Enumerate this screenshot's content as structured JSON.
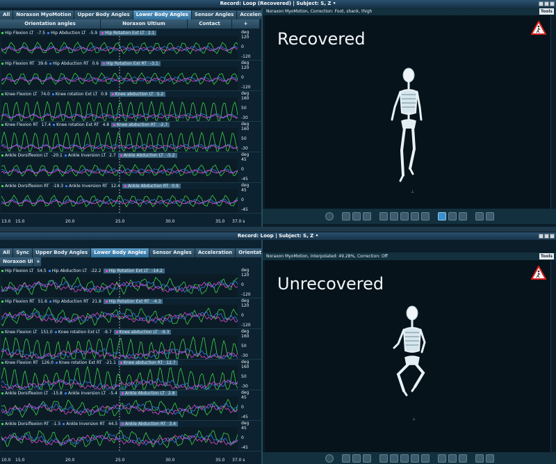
{
  "colors": {
    "green": "#3cd64a",
    "blue": "#3a78e8",
    "pink": "#e04ad0",
    "teal": "#38c0a8",
    "accent": "#3d8fcc"
  },
  "top": {
    "title": "Record: Loop (Recovered) | Subject: S, Z •",
    "tabs": [
      "All",
      "Noraxon MyoMotion",
      "Upper Body Angles",
      "Lower Body Angles",
      "Sensor Angles",
      "Acceleration"
    ],
    "active_tab": "Lower Body Angles",
    "subtabs": [
      "Orientation angles",
      "Noraxon Ultium",
      "Contact",
      "+"
    ],
    "view_header": "Noraxon MyoMotion, Correction: Foot, shank, thigh",
    "tools_label": "Tools",
    "overlay_label": "Recovered",
    "time_ticks": [
      "13.0",
      "15.0",
      "20.0",
      "25.0",
      "30.0",
      "35.0",
      "37.0 s"
    ],
    "unit": "deg",
    "rows": [
      {
        "legend": [
          {
            "label": "Hip Flexion LT",
            "value": "-7.5"
          },
          {
            "label": "Hip Abduction LT",
            "value": "-5.9"
          },
          {
            "label": "Hip Rotation Ext LT",
            "value": "2.1"
          }
        ],
        "yticks": [
          "120",
          "0",
          "-120"
        ]
      },
      {
        "legend": [
          {
            "label": "Hip Flexion RT",
            "value": "39.6"
          },
          {
            "label": "Hip Abduction RT",
            "value": "0.6"
          },
          {
            "label": "Hip Rotation Ext RT",
            "value": "-3.1"
          }
        ],
        "yticks": [
          "120",
          "0",
          "-120"
        ]
      },
      {
        "legend": [
          {
            "label": "Knee Flexion LT",
            "value": "74.0"
          },
          {
            "label": "Knee rotation Ext LT",
            "value": "0.9"
          },
          {
            "label": "Knee abduction LT",
            "value": "5.2"
          }
        ],
        "yticks": [
          "160",
          "50",
          "-30"
        ]
      },
      {
        "legend": [
          {
            "label": "Knee Flexion RT",
            "value": "17.4"
          },
          {
            "label": "Knee rotation Ext RT",
            "value": "4.8"
          },
          {
            "label": "Knee abduction RT",
            "value": "-2.7"
          }
        ],
        "yticks": [
          "160",
          "50",
          "-30"
        ]
      },
      {
        "legend": [
          {
            "label": "Ankle Dorsiflexion LT",
            "value": "-20.1"
          },
          {
            "label": "Ankle Inversion LT",
            "value": "2.7"
          },
          {
            "label": "Ankle Abduction LT",
            "value": "-5.2"
          }
        ],
        "yticks": [
          "45",
          "0",
          "-45"
        ]
      },
      {
        "legend": [
          {
            "label": "Ankle Dorsiflexion RT",
            "value": "-19.3"
          },
          {
            "label": "Ankle Inversion RT",
            "value": "12.4"
          },
          {
            "label": "Ankle Abduction RT",
            "value": "0.9"
          }
        ],
        "yticks": [
          "45",
          "0",
          "-45"
        ]
      }
    ]
  },
  "bottom": {
    "title": "Record: Loop | Subject: S, Z •",
    "tabs": [
      "All",
      "Sync",
      "Upper Body Angles",
      "Lower Body Angles",
      "Sensor Angles",
      "Acceleration",
      "Orientation angles"
    ],
    "active_tab": "Lower Body Angles",
    "subtabs": [
      "Noraxon Ultium",
      "+"
    ],
    "view_header": "Noraxon MyoMotion, Interpolated: 49.28%, Correction: Off",
    "tools_label": "Tools",
    "overlay_label": "Unrecovered",
    "time_ticks": [
      "10.0",
      "15.0",
      "20.0",
      "25.0",
      "30.0",
      "35.0",
      "37.0 s"
    ],
    "unit": "deg",
    "rows": [
      {
        "legend": [
          {
            "label": "Hip Flexion LT",
            "value": "54.5"
          },
          {
            "label": "Hip Abduction LT",
            "value": "-22.2"
          },
          {
            "label": "Hip Rotation Ext LT",
            "value": "-14.2"
          }
        ],
        "yticks": [
          "120",
          "0",
          "-120"
        ]
      },
      {
        "legend": [
          {
            "label": "Hip Flexion RT",
            "value": "51.6"
          },
          {
            "label": "Hip Abduction RT",
            "value": "21.8"
          },
          {
            "label": "Hip Rotation Ext RT",
            "value": "-4.3"
          }
        ],
        "yticks": [
          "120",
          "0",
          "-120"
        ]
      },
      {
        "legend": [
          {
            "label": "Knee Flexion LT",
            "value": "151.0"
          },
          {
            "label": "Knee rotation Ext LT",
            "value": "-9.7"
          },
          {
            "label": "Knee abduction LT",
            "value": "-9.3"
          }
        ],
        "yticks": [
          "160",
          "50",
          "-30"
        ]
      },
      {
        "legend": [
          {
            "label": "Knee Flexion RT",
            "value": "126.0"
          },
          {
            "label": "Knee rotation Ext RT",
            "value": "-21.1"
          },
          {
            "label": "Knee abduction RT",
            "value": "12.7"
          }
        ],
        "yticks": [
          "160",
          "50",
          "-30"
        ]
      },
      {
        "legend": [
          {
            "label": "Ankle Dorsiflexion LT",
            "value": "-15.8"
          },
          {
            "label": "Ankle Inversion LT",
            "value": "-5.4"
          },
          {
            "label": "Ankle Abduction LT",
            "value": "2.8"
          }
        ],
        "yticks": [
          "45",
          "0",
          "-45"
        ]
      },
      {
        "legend": [
          {
            "label": "Ankle Dorsiflexion RT",
            "value": "-1.5"
          },
          {
            "label": "Ankle Inversion RT",
            "value": "44.5"
          },
          {
            "label": "Ankle Abduction RT",
            "value": "3.4"
          }
        ],
        "yticks": [
          "45",
          "0",
          "-45"
        ]
      }
    ]
  },
  "toolbar_icons": [
    "rotate-icon",
    "zoom-in-icon",
    "zoom-out-icon",
    "zoom-fit-icon",
    "figure-front-icon",
    "figure-side-icon",
    "figure-back-icon",
    "figure-other-side-icon",
    "foot-icon",
    "percent-view-icon",
    "curve-icon",
    "grid-icon",
    "figure-marker-icon",
    "export-icon"
  ]
}
